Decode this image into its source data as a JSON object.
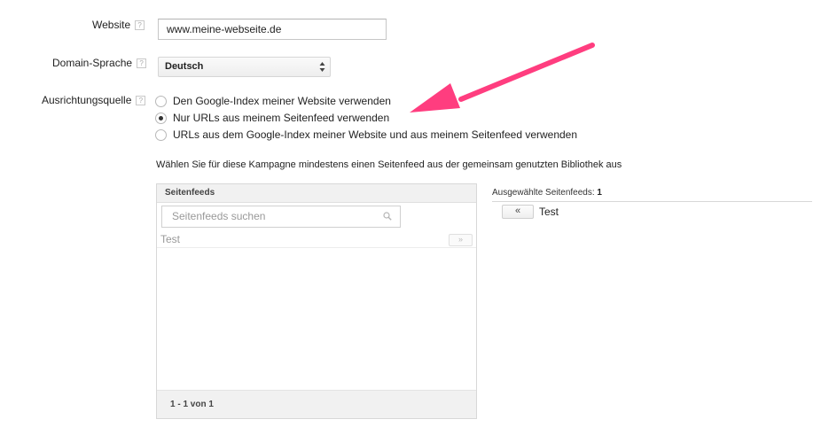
{
  "form": {
    "website": {
      "label": "Website",
      "help": "?",
      "value": "www.meine-webseite.de"
    },
    "domain_language": {
      "label": "Domain-Sprache",
      "help": "?",
      "selected": "Deutsch"
    },
    "targeting_source": {
      "label": "Ausrichtungsquelle",
      "help": "?",
      "options": [
        {
          "label": "Den Google-Index meiner Website verwenden",
          "checked": false
        },
        {
          "label": "Nur URLs aus meinem Seitenfeed verwenden",
          "checked": true
        },
        {
          "label": "URLs aus dem Google-Index meiner Website und aus meinem Seitenfeed verwenden",
          "checked": false
        }
      ]
    }
  },
  "instruction": "Wählen Sie für diese Kampagne mindestens einen Seitenfeed aus der gemeinsam genutzten Bibliothek aus",
  "feed_library": {
    "header": "Seitenfeeds",
    "search_placeholder": "Seitenfeeds suchen",
    "items": [
      {
        "label": "Test",
        "add_label": "»"
      }
    ],
    "pagination": "1 - 1 von 1"
  },
  "selected_feeds": {
    "label": "Ausgewählte Seitenfeeds:",
    "count": "1",
    "items": [
      {
        "label": "Test",
        "remove_label": "«"
      }
    ]
  },
  "colors": {
    "annotation_arrow": "#ff3d7f"
  }
}
